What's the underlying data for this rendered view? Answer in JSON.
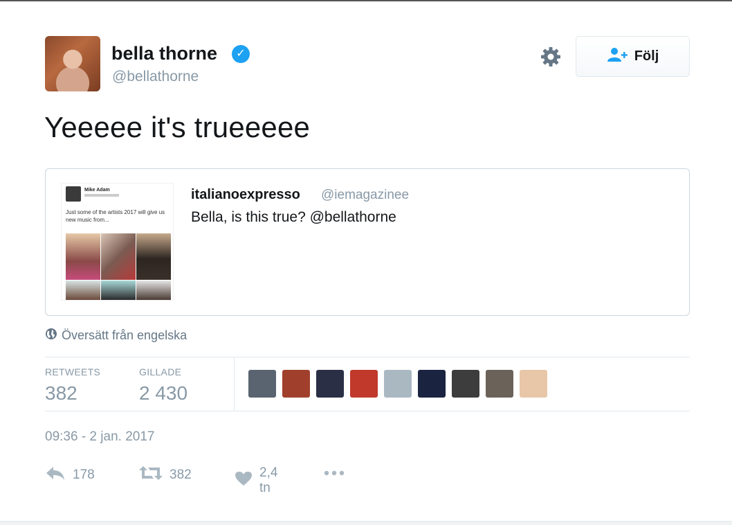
{
  "user": {
    "name": "bella thorne",
    "handle": "@bellathorne",
    "verified_icon": "verified-check-icon"
  },
  "follow_button": {
    "label": "Följ",
    "icon": "person-plus-icon"
  },
  "settings_icon": "gear-icon",
  "tweet": {
    "text": "Yeeeee it's trueeeee"
  },
  "quoted_tweet": {
    "author": "italianoexpresso",
    "handle": "@iemagazinee",
    "text": "Bella, is this true? @bellathorne",
    "image": {
      "name": "Mike Adam",
      "text": "Just some of the artists 2017 will give us new music from..."
    }
  },
  "translate": {
    "icon": "globe-icon",
    "label": "Översätt från engelska"
  },
  "stats": {
    "retweets_label": "RETWEETS",
    "retweets_value": "382",
    "likes_label": "GILLADE",
    "likes_value": "2 430"
  },
  "likers": [
    {
      "color": "#5a6470"
    },
    {
      "color": "#a0402c"
    },
    {
      "color": "#2a2f45"
    },
    {
      "color": "#c0392b"
    },
    {
      "color": "#aab8c2"
    },
    {
      "color": "#1a2340"
    },
    {
      "color": "#3d3d3d"
    },
    {
      "color": "#6b625a"
    },
    {
      "color": "#e8c6a8"
    }
  ],
  "timestamp": "09:36 - 2 jan. 2017",
  "actions": {
    "reply_count": "178",
    "retweet_count": "382",
    "like_count": "2,4 tn"
  },
  "colors": {
    "accent": "#1da1f2",
    "muted": "#8899a6",
    "border": "#e1e8ed"
  }
}
